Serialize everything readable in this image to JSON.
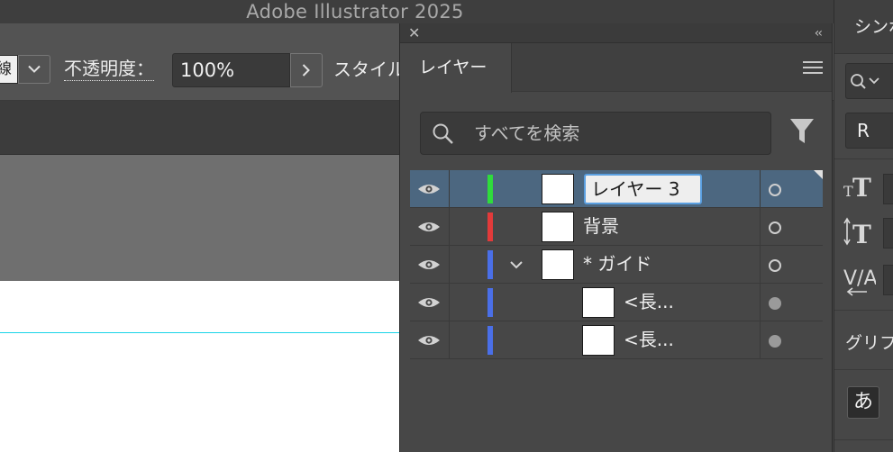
{
  "app_title": "Adobe Illustrator 2025",
  "control_bar": {
    "left_box_text": "線",
    "opacity_label": "不透明度：",
    "opacity_value": "100%",
    "style_label": "スタイル"
  },
  "canvas": {
    "guide_color": "#18d5e8"
  },
  "layers_panel": {
    "tab_label": "レイヤー",
    "search_placeholder": "すべてを検索",
    "rows": [
      {
        "name": "レイヤー 3",
        "color": "#2fdc3c",
        "selected": true,
        "editing": true,
        "expanded": null,
        "indent": 0,
        "target": "hollow"
      },
      {
        "name": "背景",
        "color": "#e23a3a",
        "selected": false,
        "editing": false,
        "expanded": null,
        "indent": 0,
        "target": "hollow"
      },
      {
        "name": "* ガイド",
        "color": "#4a6fe8",
        "selected": false,
        "editing": false,
        "expanded": true,
        "indent": 0,
        "target": "hollow"
      },
      {
        "name": "<長...",
        "color": "#4a6fe8",
        "selected": false,
        "editing": false,
        "expanded": null,
        "indent": 1,
        "target": "filled"
      },
      {
        "name": "<長...",
        "color": "#4a6fe8",
        "selected": false,
        "editing": false,
        "expanded": null,
        "indent": 1,
        "target": "filled"
      }
    ],
    "icons": [
      "close-icon",
      "collapse-icon",
      "panel-menu-icon",
      "search-icon",
      "filter-icon",
      "eye-icon",
      "chevron-down-icon",
      "target-icon"
    ]
  },
  "right_panel": {
    "tab_label": "シンボル",
    "font_value": "R",
    "glyph_label": "グリフ",
    "kana_button": "あ",
    "icons": [
      "font-search-icon",
      "font-size-icon",
      "leading-icon",
      "kerning-icon"
    ]
  },
  "colors": {
    "selection_row": "#4c6780",
    "panel_bg": "#474747",
    "accent_blue": "#5a9fe0"
  }
}
